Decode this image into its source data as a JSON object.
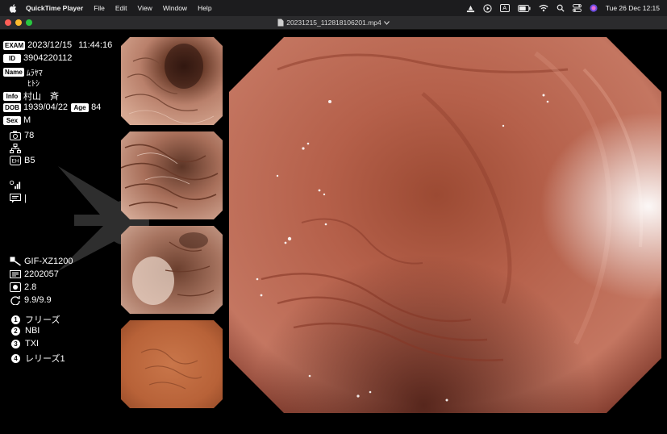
{
  "menubar": {
    "app_name": "QuickTime Player",
    "menus": [
      "File",
      "Edit",
      "View",
      "Window",
      "Help"
    ],
    "input_source": "A",
    "clock": "Tue 26 Dec  12:15"
  },
  "window": {
    "title": "20231215_112818106201.mp4",
    "lights": [
      "#ff5f57",
      "#febc2e",
      "#28c840"
    ]
  },
  "overlay": {
    "exam_tag": "EXAM",
    "exam_date": "2023/12/15",
    "exam_time": "11:44:16",
    "id_tag": "ID",
    "id_value": "3904220112",
    "name_tag": "Name",
    "name_kana_line1": "ﾑﾗﾔﾏ",
    "name_kana_line2": "ﾋﾄｼ",
    "info_tag": "Info",
    "name_kanji": "村山　斉",
    "dob_tag": "DOB",
    "dob_value": "1939/04/22",
    "age_tag": "Age",
    "age_value": "84",
    "sex_tag": "Sex",
    "sex_value": "M",
    "camera_value": "78",
    "mode_value": "B5",
    "signal_value": "|",
    "scope_model": "GIF-XZ1200",
    "scope_serial": "2202057",
    "aperture_value": "2.8",
    "ratio_value": "9.9/9.9",
    "buttons": [
      {
        "num": "1",
        "label": "フリーズ"
      },
      {
        "num": "2",
        "label": "NBI"
      },
      {
        "num": "3",
        "label": "TXI"
      },
      {
        "num": "4",
        "label": "レリーズ1"
      }
    ]
  }
}
